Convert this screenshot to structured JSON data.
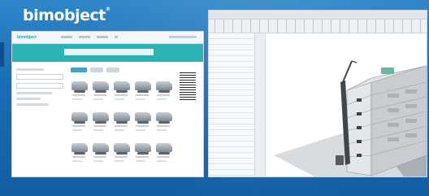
{
  "logo": {
    "text": "bimobject",
    "registered": "®"
  },
  "left_screenshot": {
    "site_logo": "bimobject"
  },
  "right_screenshot": {},
  "colors": {
    "background": "#1c6fb4",
    "hero": "#2bb3b6",
    "building_facade": "#c9cdd1",
    "ground_plane": "#d9dcdf"
  }
}
